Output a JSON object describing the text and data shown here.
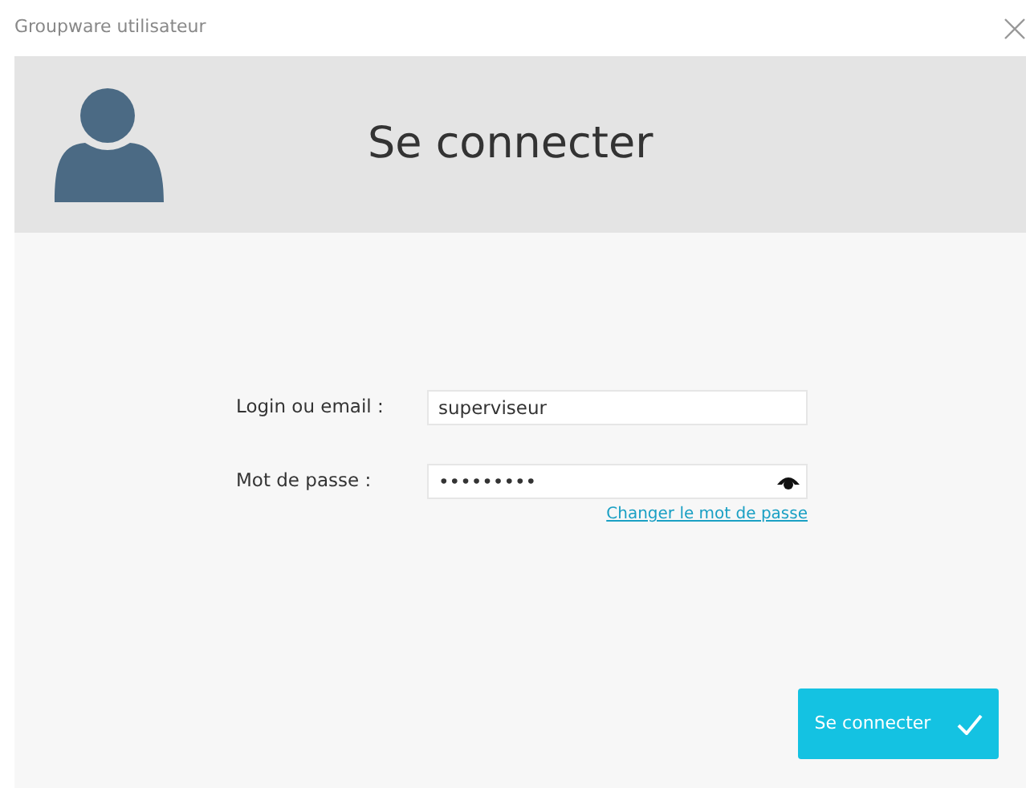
{
  "window": {
    "title": "Groupware utilisateur"
  },
  "header": {
    "title": "Se connecter"
  },
  "form": {
    "fields": [
      {
        "label": "Login ou email :",
        "value": "superviseur",
        "kind": "text"
      },
      {
        "label": "Mot de passe :",
        "value": "•••••••••",
        "kind": "password"
      }
    ],
    "link": "Changer le mot de passe"
  },
  "buttons": [
    {
      "label": "Se connecter"
    }
  ]
}
